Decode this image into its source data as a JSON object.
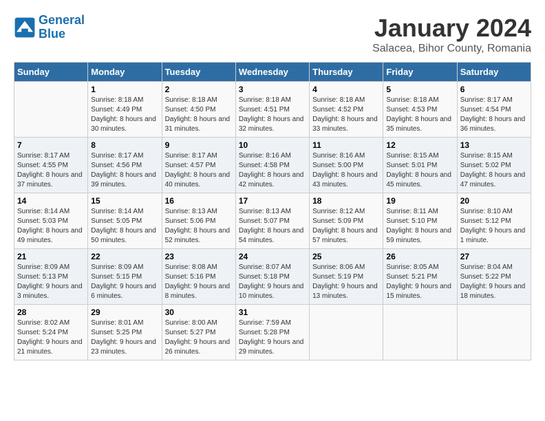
{
  "logo": {
    "text_general": "General",
    "text_blue": "Blue"
  },
  "header": {
    "title": "January 2024",
    "subtitle": "Salacea, Bihor County, Romania"
  },
  "weekdays": [
    "Sunday",
    "Monday",
    "Tuesday",
    "Wednesday",
    "Thursday",
    "Friday",
    "Saturday"
  ],
  "weeks": [
    [
      {
        "day": "",
        "sunrise": "",
        "sunset": "",
        "daylight": ""
      },
      {
        "day": "1",
        "sunrise": "Sunrise: 8:18 AM",
        "sunset": "Sunset: 4:49 PM",
        "daylight": "Daylight: 8 hours and 30 minutes."
      },
      {
        "day": "2",
        "sunrise": "Sunrise: 8:18 AM",
        "sunset": "Sunset: 4:50 PM",
        "daylight": "Daylight: 8 hours and 31 minutes."
      },
      {
        "day": "3",
        "sunrise": "Sunrise: 8:18 AM",
        "sunset": "Sunset: 4:51 PM",
        "daylight": "Daylight: 8 hours and 32 minutes."
      },
      {
        "day": "4",
        "sunrise": "Sunrise: 8:18 AM",
        "sunset": "Sunset: 4:52 PM",
        "daylight": "Daylight: 8 hours and 33 minutes."
      },
      {
        "day": "5",
        "sunrise": "Sunrise: 8:18 AM",
        "sunset": "Sunset: 4:53 PM",
        "daylight": "Daylight: 8 hours and 35 minutes."
      },
      {
        "day": "6",
        "sunrise": "Sunrise: 8:17 AM",
        "sunset": "Sunset: 4:54 PM",
        "daylight": "Daylight: 8 hours and 36 minutes."
      }
    ],
    [
      {
        "day": "7",
        "sunrise": "Sunrise: 8:17 AM",
        "sunset": "Sunset: 4:55 PM",
        "daylight": "Daylight: 8 hours and 37 minutes."
      },
      {
        "day": "8",
        "sunrise": "Sunrise: 8:17 AM",
        "sunset": "Sunset: 4:56 PM",
        "daylight": "Daylight: 8 hours and 39 minutes."
      },
      {
        "day": "9",
        "sunrise": "Sunrise: 8:17 AM",
        "sunset": "Sunset: 4:57 PM",
        "daylight": "Daylight: 8 hours and 40 minutes."
      },
      {
        "day": "10",
        "sunrise": "Sunrise: 8:16 AM",
        "sunset": "Sunset: 4:58 PM",
        "daylight": "Daylight: 8 hours and 42 minutes."
      },
      {
        "day": "11",
        "sunrise": "Sunrise: 8:16 AM",
        "sunset": "Sunset: 5:00 PM",
        "daylight": "Daylight: 8 hours and 43 minutes."
      },
      {
        "day": "12",
        "sunrise": "Sunrise: 8:15 AM",
        "sunset": "Sunset: 5:01 PM",
        "daylight": "Daylight: 8 hours and 45 minutes."
      },
      {
        "day": "13",
        "sunrise": "Sunrise: 8:15 AM",
        "sunset": "Sunset: 5:02 PM",
        "daylight": "Daylight: 8 hours and 47 minutes."
      }
    ],
    [
      {
        "day": "14",
        "sunrise": "Sunrise: 8:14 AM",
        "sunset": "Sunset: 5:03 PM",
        "daylight": "Daylight: 8 hours and 49 minutes."
      },
      {
        "day": "15",
        "sunrise": "Sunrise: 8:14 AM",
        "sunset": "Sunset: 5:05 PM",
        "daylight": "Daylight: 8 hours and 50 minutes."
      },
      {
        "day": "16",
        "sunrise": "Sunrise: 8:13 AM",
        "sunset": "Sunset: 5:06 PM",
        "daylight": "Daylight: 8 hours and 52 minutes."
      },
      {
        "day": "17",
        "sunrise": "Sunrise: 8:13 AM",
        "sunset": "Sunset: 5:07 PM",
        "daylight": "Daylight: 8 hours and 54 minutes."
      },
      {
        "day": "18",
        "sunrise": "Sunrise: 8:12 AM",
        "sunset": "Sunset: 5:09 PM",
        "daylight": "Daylight: 8 hours and 57 minutes."
      },
      {
        "day": "19",
        "sunrise": "Sunrise: 8:11 AM",
        "sunset": "Sunset: 5:10 PM",
        "daylight": "Daylight: 8 hours and 59 minutes."
      },
      {
        "day": "20",
        "sunrise": "Sunrise: 8:10 AM",
        "sunset": "Sunset: 5:12 PM",
        "daylight": "Daylight: 9 hours and 1 minute."
      }
    ],
    [
      {
        "day": "21",
        "sunrise": "Sunrise: 8:09 AM",
        "sunset": "Sunset: 5:13 PM",
        "daylight": "Daylight: 9 hours and 3 minutes."
      },
      {
        "day": "22",
        "sunrise": "Sunrise: 8:09 AM",
        "sunset": "Sunset: 5:15 PM",
        "daylight": "Daylight: 9 hours and 6 minutes."
      },
      {
        "day": "23",
        "sunrise": "Sunrise: 8:08 AM",
        "sunset": "Sunset: 5:16 PM",
        "daylight": "Daylight: 9 hours and 8 minutes."
      },
      {
        "day": "24",
        "sunrise": "Sunrise: 8:07 AM",
        "sunset": "Sunset: 5:18 PM",
        "daylight": "Daylight: 9 hours and 10 minutes."
      },
      {
        "day": "25",
        "sunrise": "Sunrise: 8:06 AM",
        "sunset": "Sunset: 5:19 PM",
        "daylight": "Daylight: 9 hours and 13 minutes."
      },
      {
        "day": "26",
        "sunrise": "Sunrise: 8:05 AM",
        "sunset": "Sunset: 5:21 PM",
        "daylight": "Daylight: 9 hours and 15 minutes."
      },
      {
        "day": "27",
        "sunrise": "Sunrise: 8:04 AM",
        "sunset": "Sunset: 5:22 PM",
        "daylight": "Daylight: 9 hours and 18 minutes."
      }
    ],
    [
      {
        "day": "28",
        "sunrise": "Sunrise: 8:02 AM",
        "sunset": "Sunset: 5:24 PM",
        "daylight": "Daylight: 9 hours and 21 minutes."
      },
      {
        "day": "29",
        "sunrise": "Sunrise: 8:01 AM",
        "sunset": "Sunset: 5:25 PM",
        "daylight": "Daylight: 9 hours and 23 minutes."
      },
      {
        "day": "30",
        "sunrise": "Sunrise: 8:00 AM",
        "sunset": "Sunset: 5:27 PM",
        "daylight": "Daylight: 9 hours and 26 minutes."
      },
      {
        "day": "31",
        "sunrise": "Sunrise: 7:59 AM",
        "sunset": "Sunset: 5:28 PM",
        "daylight": "Daylight: 9 hours and 29 minutes."
      },
      {
        "day": "",
        "sunrise": "",
        "sunset": "",
        "daylight": ""
      },
      {
        "day": "",
        "sunrise": "",
        "sunset": "",
        "daylight": ""
      },
      {
        "day": "",
        "sunrise": "",
        "sunset": "",
        "daylight": ""
      }
    ]
  ]
}
